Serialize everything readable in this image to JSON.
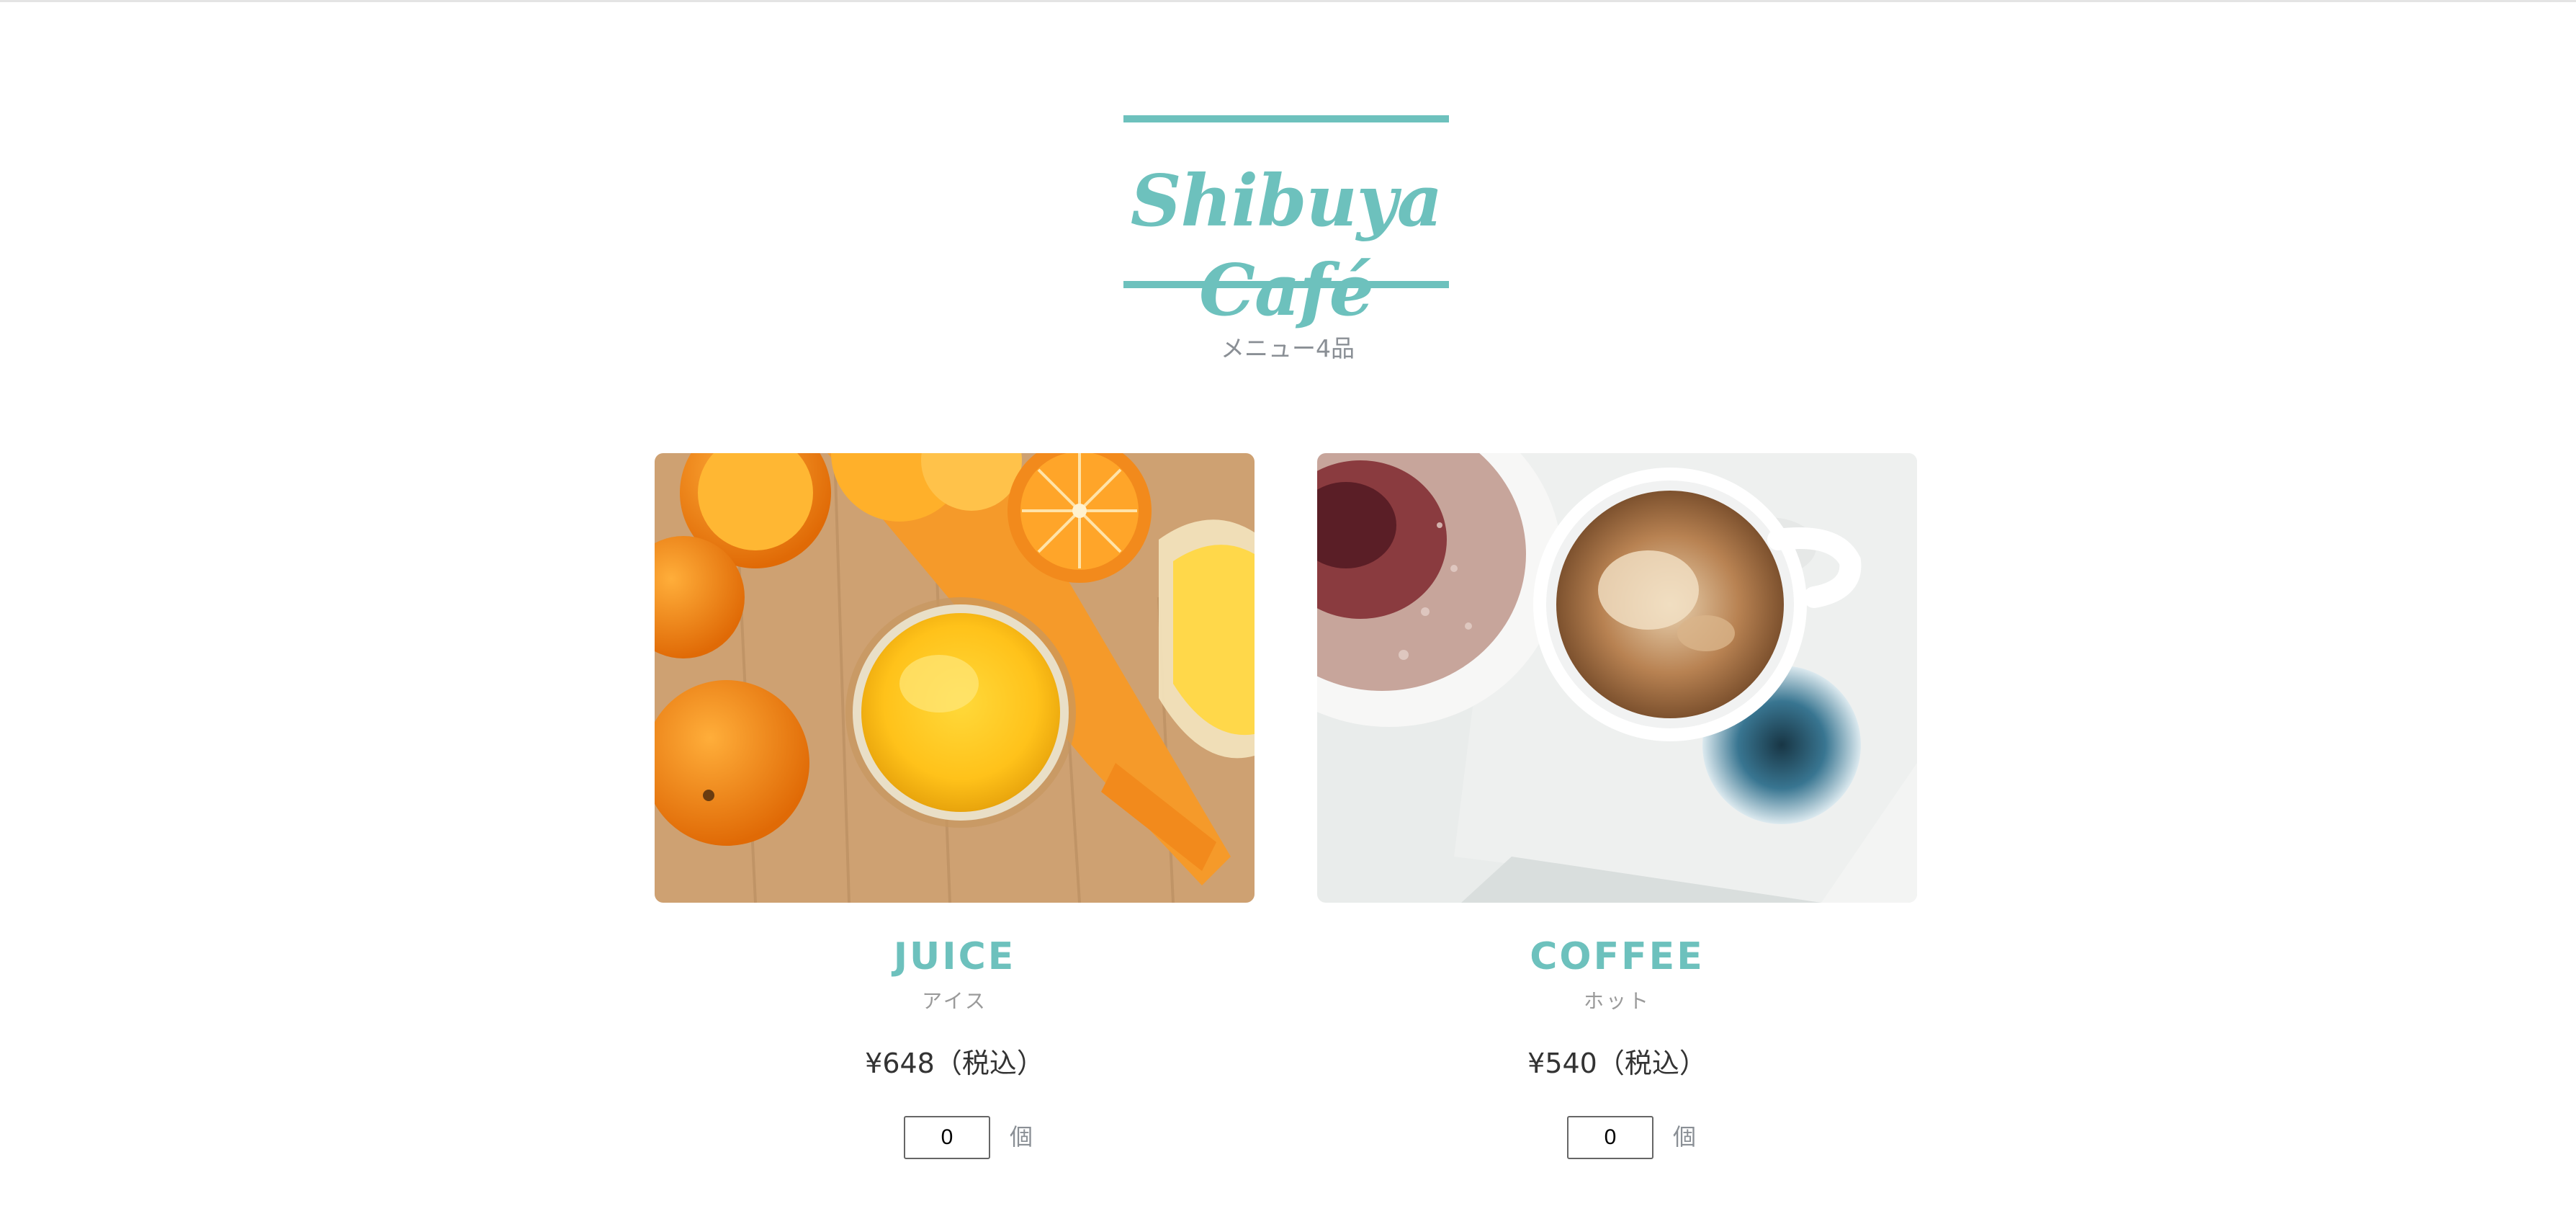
{
  "header": {
    "brand_name": "Shibuya Café",
    "menu_count": "メニュー4品",
    "accent_color": "#6dc1bd"
  },
  "menu": {
    "items": [
      {
        "name": "JUICE",
        "subtitle": "アイス",
        "price": "¥648（税込）",
        "quantity": "0",
        "unit": "個",
        "image": "orange-juice-photo"
      },
      {
        "name": "COFFEE",
        "subtitle": "ホット",
        "price": "¥540（税込）",
        "quantity": "0",
        "unit": "個",
        "image": "coffee-cup-photo"
      }
    ]
  }
}
